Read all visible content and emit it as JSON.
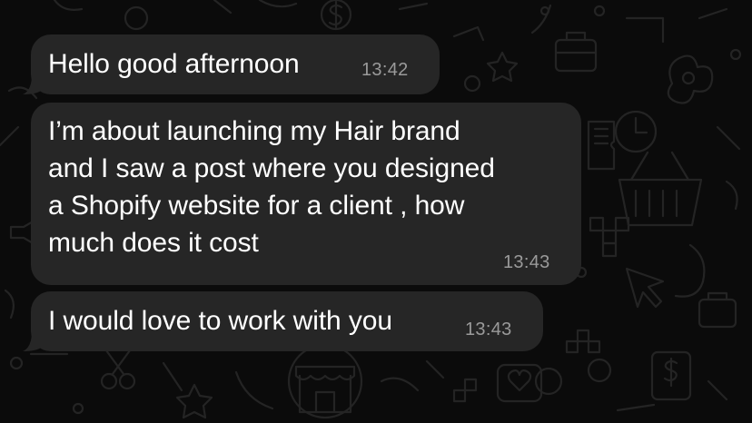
{
  "theme": {
    "background": "#0b0b0b",
    "bubble_incoming": "#262626",
    "text_color": "#ffffff",
    "timestamp_color": "#9a9a9a",
    "wallpaper_doodle_color": "#242424"
  },
  "wallpaper": {
    "icons": [
      "dollar-sign-icon",
      "shopping-basket-icon",
      "clock-icon",
      "briefcase-icon",
      "ticket-icon",
      "heart-icon",
      "cursor-icon",
      "puzzle-icon",
      "flower-icon",
      "storefront-icon",
      "star-icon",
      "scissors-icon",
      "megaphone-icon"
    ]
  },
  "messages": [
    {
      "text": "Hello good afternoon",
      "time": "13:42"
    },
    {
      "text": "I’m about launching my Hair brand\nand I saw a post where you designed\na Shopify website for a client , how\nmuch does it cost",
      "time": "13:43"
    },
    {
      "text": "I would love to work with you",
      "time": "13:43"
    }
  ]
}
